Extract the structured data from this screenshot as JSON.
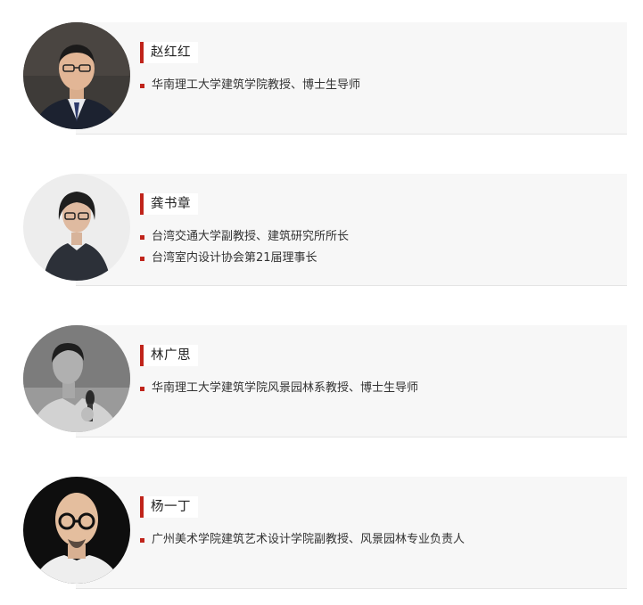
{
  "people": [
    {
      "name": "赵红红",
      "details": [
        "华南理工大学建筑学院教授、博士生导师"
      ]
    },
    {
      "name": "龚书章",
      "details": [
        "台湾交通大学副教授、建筑研究所所长",
        "台湾室内设计协会第21届理事长"
      ]
    },
    {
      "name": "林广思",
      "details": [
        "华南理工大学建筑学院风景园林系教授、博士生导师"
      ]
    },
    {
      "name": "杨一丁",
      "details": [
        "广州美术学院建筑艺术设计学院副教授、风景园林专业负责人"
      ]
    }
  ]
}
